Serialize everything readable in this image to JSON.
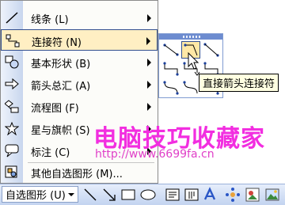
{
  "menu": {
    "items": [
      {
        "label": "线条 (L)",
        "has_submenu": true,
        "icon": "line-icon"
      },
      {
        "label": "连接符 (N)",
        "has_submenu": true,
        "icon": "connector-icon",
        "highlighted": true
      },
      {
        "label": "基本形状 (B)",
        "has_submenu": true,
        "icon": "basic-shapes-icon"
      },
      {
        "label": "箭头总汇 (A)",
        "has_submenu": true,
        "icon": "block-arrows-icon"
      },
      {
        "label": "流程图 (F)",
        "has_submenu": true,
        "icon": "flowchart-icon"
      },
      {
        "label": "星与旗帜 (S)",
        "has_submenu": true,
        "icon": "stars-banners-icon"
      },
      {
        "label": "标注 (C)",
        "has_submenu": true,
        "icon": "callouts-icon"
      },
      {
        "label": "其他自选图形 (M)...",
        "has_submenu": false,
        "icon": "more-autoshapes-icon"
      }
    ]
  },
  "submenu": {
    "selected_item": "elbow-arrow-connector"
  },
  "tooltip": {
    "text": "直接箭头连接符"
  },
  "watermark": {
    "title": "电脑技巧收藏家",
    "url": "http://www.6699fa.cn"
  },
  "toolbar": {
    "autoshapes_label": "自选图形 (U)"
  },
  "colors": {
    "highlight": "#ffefc3",
    "watermark": "#f22ee0",
    "toolbar": "#c3d4f0"
  }
}
